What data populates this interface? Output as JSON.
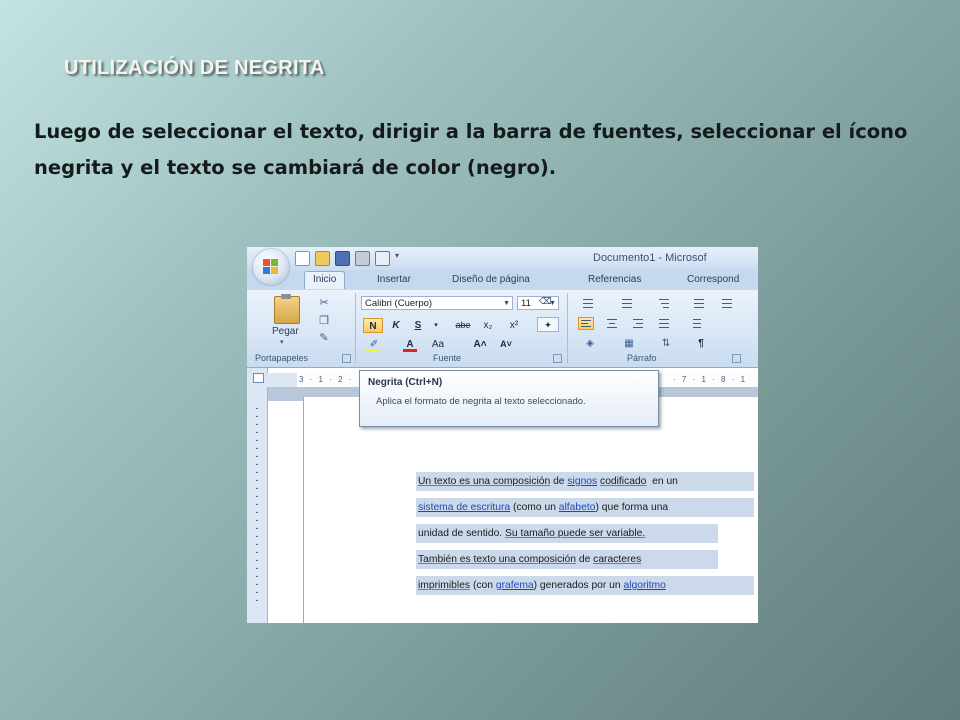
{
  "slide": {
    "title": "UTILIZACIÓN DE NEGRITA",
    "body": "Luego de seleccionar el texto, dirigir a la barra de fuentes, seleccionar el ícono negrita y el texto se cambiará de color (negro)."
  },
  "word": {
    "window_title": "Documento1 - Microsof",
    "tabs": [
      "Inicio",
      "Insertar",
      "Diseño de página",
      "Referencias",
      "Correspond"
    ],
    "active_tab": "Inicio",
    "clipboard": {
      "paste_label": "Pegar",
      "group_label": "Portapapeles"
    },
    "font": {
      "font_name": "Calibri (Cuerpo)",
      "font_size": "11",
      "group_label": "Fuente",
      "bold": "N",
      "italic": "K",
      "underline": "S",
      "strikethrough": "abe",
      "subscript": "x₂",
      "superscript": "x²",
      "change_case": "Aa",
      "grow_font": "A˄",
      "shrink_font": "A˅"
    },
    "paragraph": {
      "group_label": "Párrafo",
      "show_marks": "¶"
    },
    "ruler_left": "3 · 1 · 2 ·",
    "ruler_right": "· 7 · 1 · 8 · 1",
    "tooltip": {
      "title": "Negrita (Ctrl+N)",
      "description": "Aplica el formato de negrita al texto seleccionado."
    },
    "document_lines": [
      {
        "parts": [
          {
            "t": "Un texto es una composición",
            "c": "u"
          },
          {
            "t": " de ",
            "c": ""
          },
          {
            "t": "signos",
            "c": "l"
          },
          {
            "t": " ",
            "c": ""
          },
          {
            "t": "codificado",
            "c": "u"
          },
          {
            "t": "  en un",
            "c": ""
          }
        ]
      },
      {
        "parts": [
          {
            "t": "sistema de escritura",
            "c": "l"
          },
          {
            "t": " (como un ",
            "c": ""
          },
          {
            "t": "alfabeto",
            "c": "l"
          },
          {
            "t": ") que forma una",
            "c": ""
          }
        ]
      },
      {
        "parts": [
          {
            "t": "unidad de sentido. ",
            "c": ""
          },
          {
            "t": "Su tamaño puede ser variable.",
            "c": "u"
          }
        ]
      },
      {
        "parts": [
          {
            "t": "También es texto una composición",
            "c": "u"
          },
          {
            "t": " de ",
            "c": ""
          },
          {
            "t": "caracteres",
            "c": "u"
          }
        ]
      },
      {
        "parts": [
          {
            "t": "imprimibles",
            "c": "u"
          },
          {
            "t": " (con ",
            "c": ""
          },
          {
            "t": "grafema",
            "c": "l"
          },
          {
            "t": ") generados por un ",
            "c": ""
          },
          {
            "t": "algoritmo",
            "c": "l"
          }
        ]
      }
    ]
  }
}
